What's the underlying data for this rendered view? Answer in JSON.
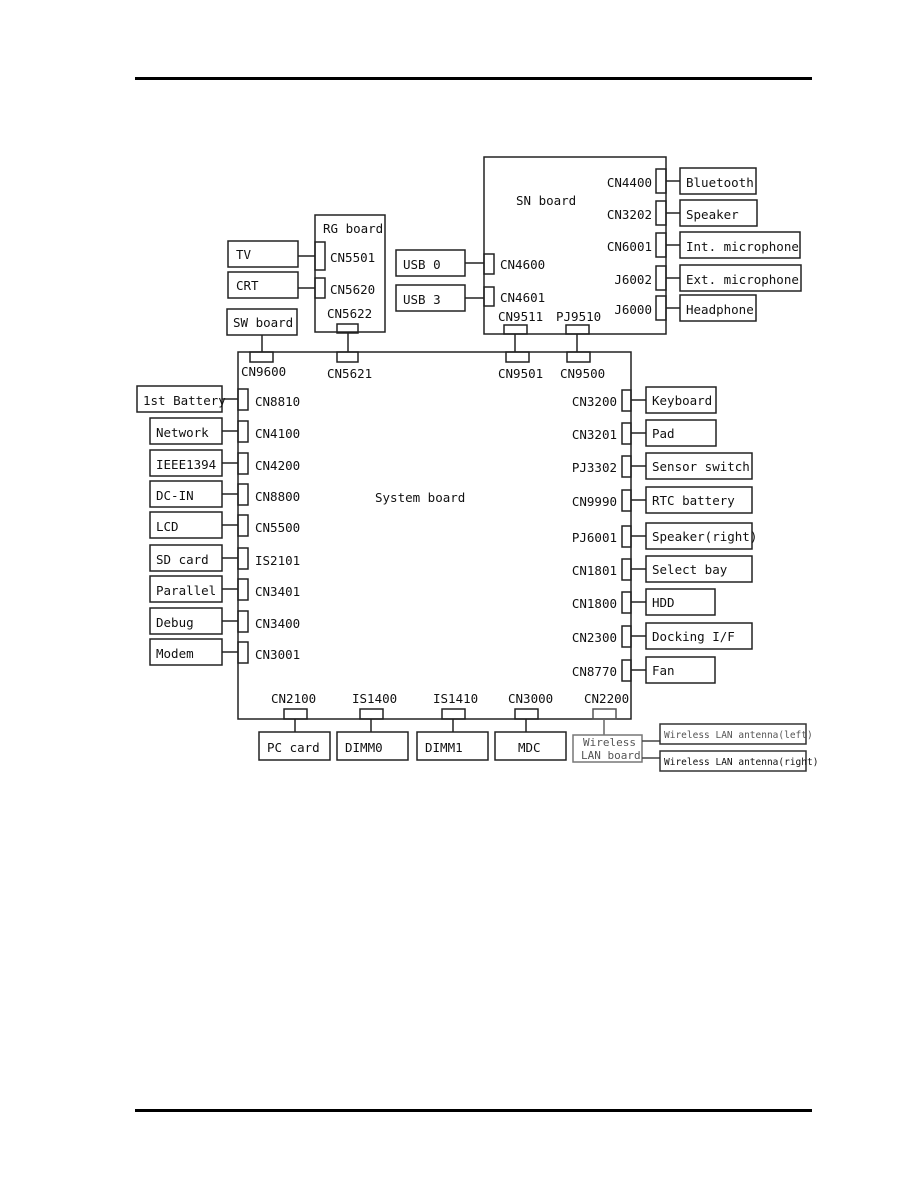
{
  "boards": {
    "system": "System board",
    "sn": "SN board",
    "rg": "RG board",
    "sw": "SW board",
    "wlan": [
      "Wireless",
      "LAN board"
    ]
  },
  "rg_devices": [
    {
      "device": "TV",
      "connector": "CN5501"
    },
    {
      "device": "CRT",
      "connector": "CN5620"
    }
  ],
  "usb_devices": [
    {
      "device": "USB 0",
      "connector": "CN4600"
    },
    {
      "device": "USB 3",
      "connector": "CN4601"
    }
  ],
  "sn_devices": [
    {
      "device": "Bluetooth",
      "connector": "CN4400"
    },
    {
      "device": "Speaker",
      "connector": "CN3202"
    },
    {
      "device": "Int. microphone",
      "connector": "CN6001"
    },
    {
      "device": "Ext. microphone",
      "connector": "J6002"
    },
    {
      "device": "Headphone",
      "connector": "J6000"
    }
  ],
  "links": {
    "sw_system": "CN9600",
    "rg_board": "CN5622",
    "rg_system": "CN5621",
    "sn_board_a": "CN9511",
    "sn_board_b": "PJ9510",
    "sn_system_a": "CN9501",
    "sn_system_b": "CN9500"
  },
  "left_devices": [
    {
      "device": "1st Battery",
      "connector": "CN8810"
    },
    {
      "device": "Network",
      "connector": "CN4100"
    },
    {
      "device": "IEEE1394",
      "connector": "CN4200"
    },
    {
      "device": "DC-IN",
      "connector": "CN8800"
    },
    {
      "device": "LCD",
      "connector": "CN5500"
    },
    {
      "device": "SD card",
      "connector": "IS2101"
    },
    {
      "device": "Parallel",
      "connector": "CN3401"
    },
    {
      "device": "Debug",
      "connector": "CN3400"
    },
    {
      "device": "Modem",
      "connector": "CN3001"
    }
  ],
  "right_devices": [
    {
      "device": "Keyboard",
      "connector": "CN3200"
    },
    {
      "device": "Pad",
      "connector": "CN3201"
    },
    {
      "device": "Sensor switch",
      "connector": "PJ3302"
    },
    {
      "device": "RTC battery",
      "connector": "CN9990"
    },
    {
      "device": "Speaker(right)",
      "connector": "PJ6001"
    },
    {
      "device": "Select bay",
      "connector": "CN1801"
    },
    {
      "device": "HDD",
      "connector": "CN1800"
    },
    {
      "device": "Docking I/F",
      "connector": "CN2300"
    },
    {
      "device": "Fan",
      "connector": "CN8770"
    }
  ],
  "bottom_devices": [
    {
      "device": "PC card",
      "connector": "CN2100"
    },
    {
      "device": "DIMM0",
      "connector": "IS1400"
    },
    {
      "device": "DIMM1",
      "connector": "IS1410"
    },
    {
      "device": "MDC",
      "connector": "CN3000"
    },
    {
      "device": "",
      "connector": "CN2200"
    }
  ],
  "antennas": [
    "Wireless LAN antenna(left)",
    "Wireless LAN antenna(right)"
  ]
}
